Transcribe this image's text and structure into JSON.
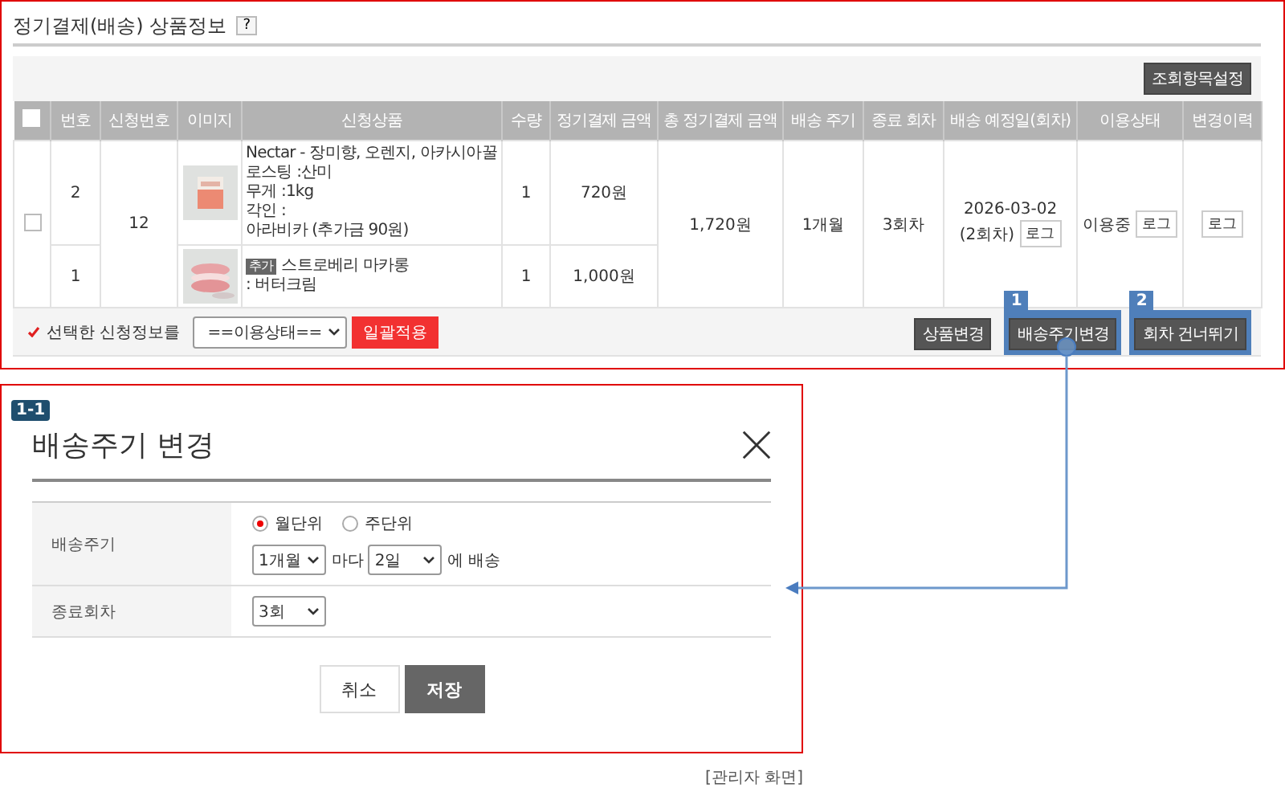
{
  "section": {
    "title": "정기결제(배송) 상품정보",
    "help": "?"
  },
  "toolbar": {
    "button": "조회항목설정"
  },
  "table": {
    "header_checked": false,
    "columns": [
      "번호",
      "신청번호",
      "이미지",
      "신청상품",
      "수량",
      "정기결제 금액",
      "총 정기결제 금액",
      "배송 주기",
      "종료 회차",
      "배송 예정일(회차)",
      "이용상태",
      "변경이력"
    ],
    "group": {
      "checked": false,
      "application_no": "12",
      "total": "1,720원",
      "cycle": "1개월",
      "end_round": "3회차",
      "scheduled_date": "2026-03-02",
      "scheduled_round": "(2회차)",
      "schedule_log": "로그",
      "status": "이용중",
      "status_log": "로그",
      "history_log": "로그",
      "items": [
        {
          "no": "2",
          "image": {
            "kind": "picture"
          },
          "product_lines": [
            "Nectar - 장미향, 오렌지, 아카시아꿀",
            "로스팅 :산미",
            "무게 :1kg",
            "각인 :",
            "아라비카 (추가금 90원)"
          ],
          "qty": "1",
          "amount": "720원"
        },
        {
          "no": "1",
          "image": {
            "kind": "picture"
          },
          "tag": "추가",
          "product_lines": [
            "스트로베리 마카롱",
            ": 버터크림"
          ],
          "qty": "1",
          "amount": "1,000원"
        }
      ]
    }
  },
  "footer": {
    "label": "선택한 신청정보를",
    "status_select": "==이용상태==",
    "apply": "일괄적용",
    "buttons": [
      {
        "label": "상품변경"
      },
      {
        "label": "배송주기변경",
        "badge": "1"
      },
      {
        "label": "회차 건너뛰기",
        "badge": "2"
      }
    ]
  },
  "modal": {
    "badge": "1-1",
    "title": "배송주기 변경",
    "rows": [
      {
        "kind": "cycle",
        "label": "배송주기",
        "radios": [
          {
            "label": "월단위",
            "selected": true
          },
          {
            "label": "주단위",
            "selected": false
          }
        ],
        "period": "1개월",
        "between": "마다",
        "day": "2일",
        "after": "에 배송"
      },
      {
        "kind": "select",
        "label": "종료회차",
        "value": "3회"
      }
    ],
    "buttons": [
      {
        "kind": "secondary",
        "label": "취소"
      },
      {
        "kind": "primary",
        "label": "저장"
      }
    ]
  },
  "caption": "[관리자 화면]"
}
